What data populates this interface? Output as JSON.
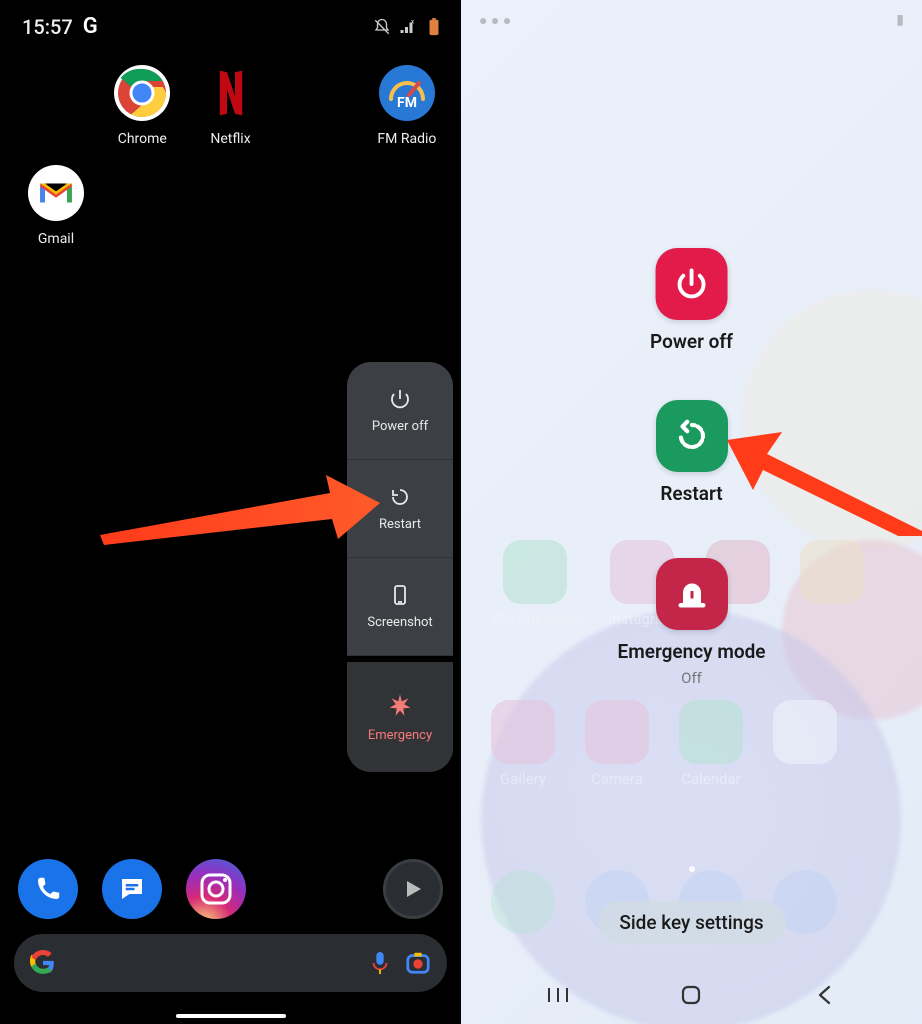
{
  "left": {
    "status": {
      "time": "15:57",
      "g": "G"
    },
    "apps_top": [
      {
        "name": "chrome",
        "label": "Chrome"
      },
      {
        "name": "netflix",
        "label": "Netflix"
      },
      {
        "name": "spacer",
        "label": ""
      },
      {
        "name": "fmradio",
        "label": "FM Radio"
      }
    ],
    "apps_second": [
      {
        "name": "gmail",
        "label": "Gmail"
      }
    ],
    "power_menu": [
      {
        "key": "poweroff",
        "label": "Power off"
      },
      {
        "key": "restart",
        "label": "Restart"
      },
      {
        "key": "screenshot",
        "label": "Screenshot"
      }
    ],
    "emergency_label": "Emergency"
  },
  "right": {
    "items": [
      {
        "key": "poweroff",
        "label": "Power off",
        "color": "#e31b4b"
      },
      {
        "key": "restart",
        "label": "Restart",
        "color": "#1a9a5f"
      },
      {
        "key": "emergency",
        "label": "Emergency mode",
        "sub": "Off",
        "color": "#c4264a"
      }
    ],
    "sidekey": "Side key settings",
    "ghost_row2": [
      "WA Business",
      "Instagram",
      "",
      ""
    ],
    "ghost_row3": [
      "Gallery",
      "Camera",
      "Calendar",
      ""
    ]
  }
}
